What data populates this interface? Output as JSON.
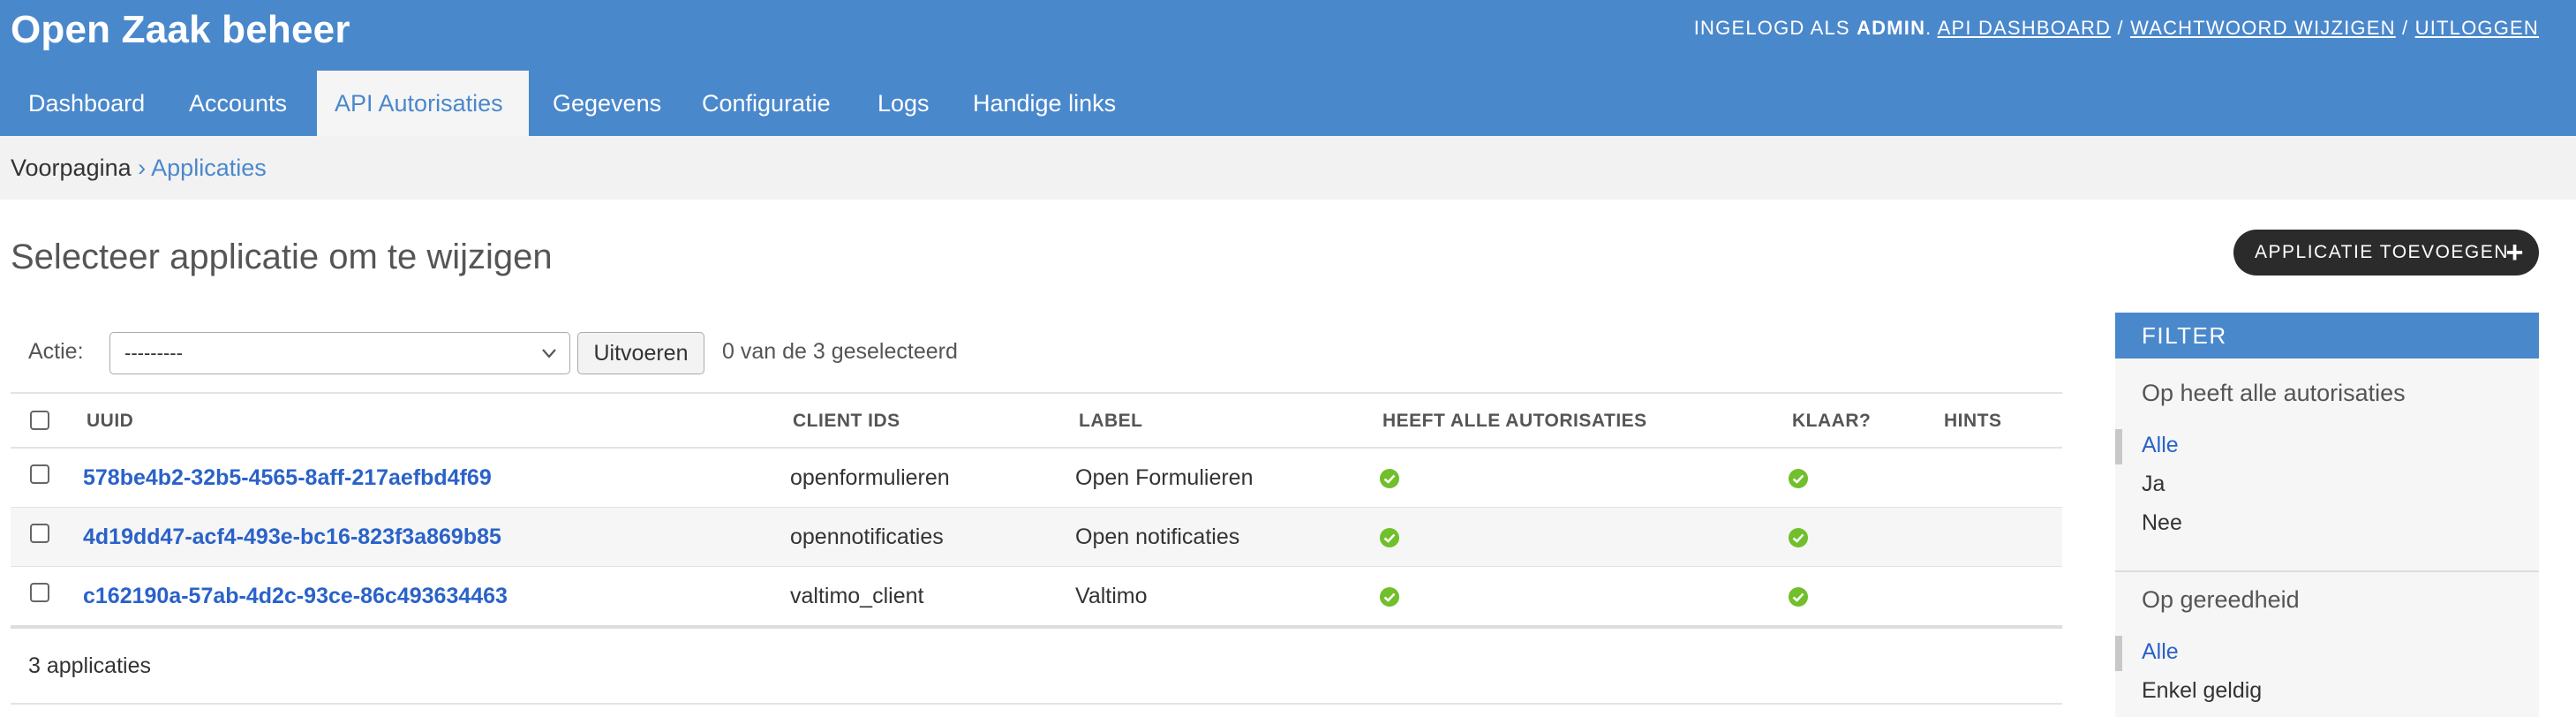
{
  "header": {
    "brand": "Open Zaak beheer",
    "user_prefix": "INGELOGD ALS",
    "username": "ADMIN",
    "links": [
      "API DASHBOARD",
      "WACHTWOORD WIJZIGEN",
      "UITLOGGEN"
    ],
    "separator": "/"
  },
  "nav": {
    "items": [
      "Dashboard",
      "Accounts",
      "API Autorisaties",
      "Gegevens",
      "Configuratie",
      "Logs",
      "Handige links"
    ],
    "active": "API Autorisaties"
  },
  "breadcrumbs": {
    "home": "Voorpagina",
    "separator": "›",
    "current": "Applicaties"
  },
  "page": {
    "title": "Selecteer applicatie om te wijzigen",
    "add_button": "APPLICATIE TOEVOEGEN",
    "add_icon": "plus-icon"
  },
  "actions": {
    "label": "Actie:",
    "selected_option": "---------",
    "run_button": "Uitvoeren",
    "selected_count": "0 van de 3 geselecteerd"
  },
  "table": {
    "columns": [
      "UUID",
      "CLIENT IDS",
      "LABEL",
      "HEEFT ALLE AUTORISATIES",
      "KLAAR?",
      "HINTS"
    ],
    "rows": [
      {
        "uuid": "578be4b2-32b5-4565-8aff-217aefbd4f69",
        "client_ids": "openformulieren",
        "label": "Open Formulieren",
        "all_authorizations": true,
        "ready": true,
        "hints": ""
      },
      {
        "uuid": "4d19dd47-acf4-493e-bc16-823f3a869b85",
        "client_ids": "opennotificaties",
        "label": "Open notificaties",
        "all_authorizations": true,
        "ready": true,
        "hints": ""
      },
      {
        "uuid": "c162190a-57ab-4d2c-93ce-86c493634463",
        "client_ids": "valtimo_client",
        "label": "Valtimo",
        "all_authorizations": true,
        "ready": true,
        "hints": ""
      }
    ],
    "status_icon": "check-circle-icon",
    "status_color": "#70bf2b",
    "footer": "3 applicaties"
  },
  "filter": {
    "heading": "FILTER",
    "groups": [
      {
        "title": "Op heeft alle autorisaties",
        "options": [
          "Alle",
          "Ja",
          "Nee"
        ],
        "selected": "Alle"
      },
      {
        "title": "Op gereedheid",
        "options": [
          "Alle",
          "Enkel geldig"
        ],
        "selected": "Alle"
      }
    ]
  },
  "colors": {
    "primary": "#4a88cc",
    "link": "#2a62c9",
    "dark_button": "#2b2b2b"
  }
}
